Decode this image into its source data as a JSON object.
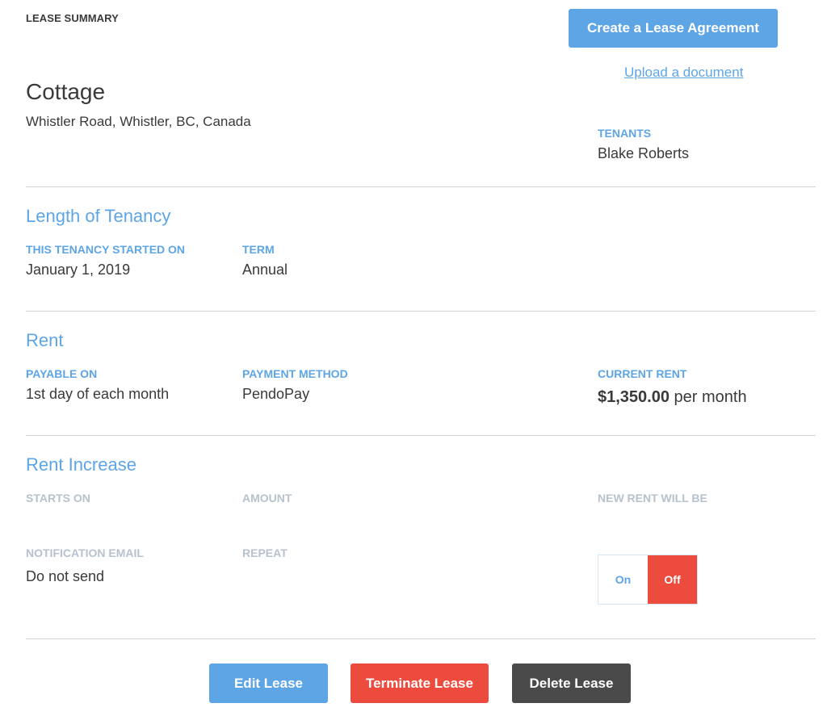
{
  "header": {
    "kicker": "LEASE SUMMARY",
    "create_button": "Create a Lease Agreement",
    "upload_link": "Upload a document"
  },
  "property": {
    "name": "Cottage",
    "address": "Whistler Road, Whistler, BC, Canada"
  },
  "tenants": {
    "label": "TENANTS",
    "names": "Blake Roberts"
  },
  "tenancy": {
    "title": "Length of Tenancy",
    "started_label": "THIS TENANCY STARTED ON",
    "started_value": "January 1, 2019",
    "term_label": "TERM",
    "term_value": "Annual"
  },
  "rent": {
    "title": "Rent",
    "payable_label": "PAYABLE ON",
    "payable_value": "1st day of each month",
    "method_label": "PAYMENT METHOD",
    "method_value": "PendoPay",
    "current_label": "CURRENT RENT",
    "current_amount": "$1,350.00",
    "current_period": " per month"
  },
  "increase": {
    "title": "Rent Increase",
    "starts_label": "STARTS ON",
    "amount_label": "AMOUNT",
    "new_rent_label": "NEW RENT WILL BE",
    "email_label": "NOTIFICATION EMAIL",
    "email_value": "Do not send",
    "repeat_label": "REPEAT",
    "toggle_on": "On",
    "toggle_off": "Off",
    "toggle_state": "Off"
  },
  "actions": {
    "edit": "Edit Lease",
    "terminate": "Terminate Lease",
    "delete": "Delete Lease"
  },
  "colors": {
    "accent": "#5ea5e6",
    "danger": "#ec4b3e",
    "dark": "#4a4a4a",
    "muted_label": "#b7c2cc"
  }
}
